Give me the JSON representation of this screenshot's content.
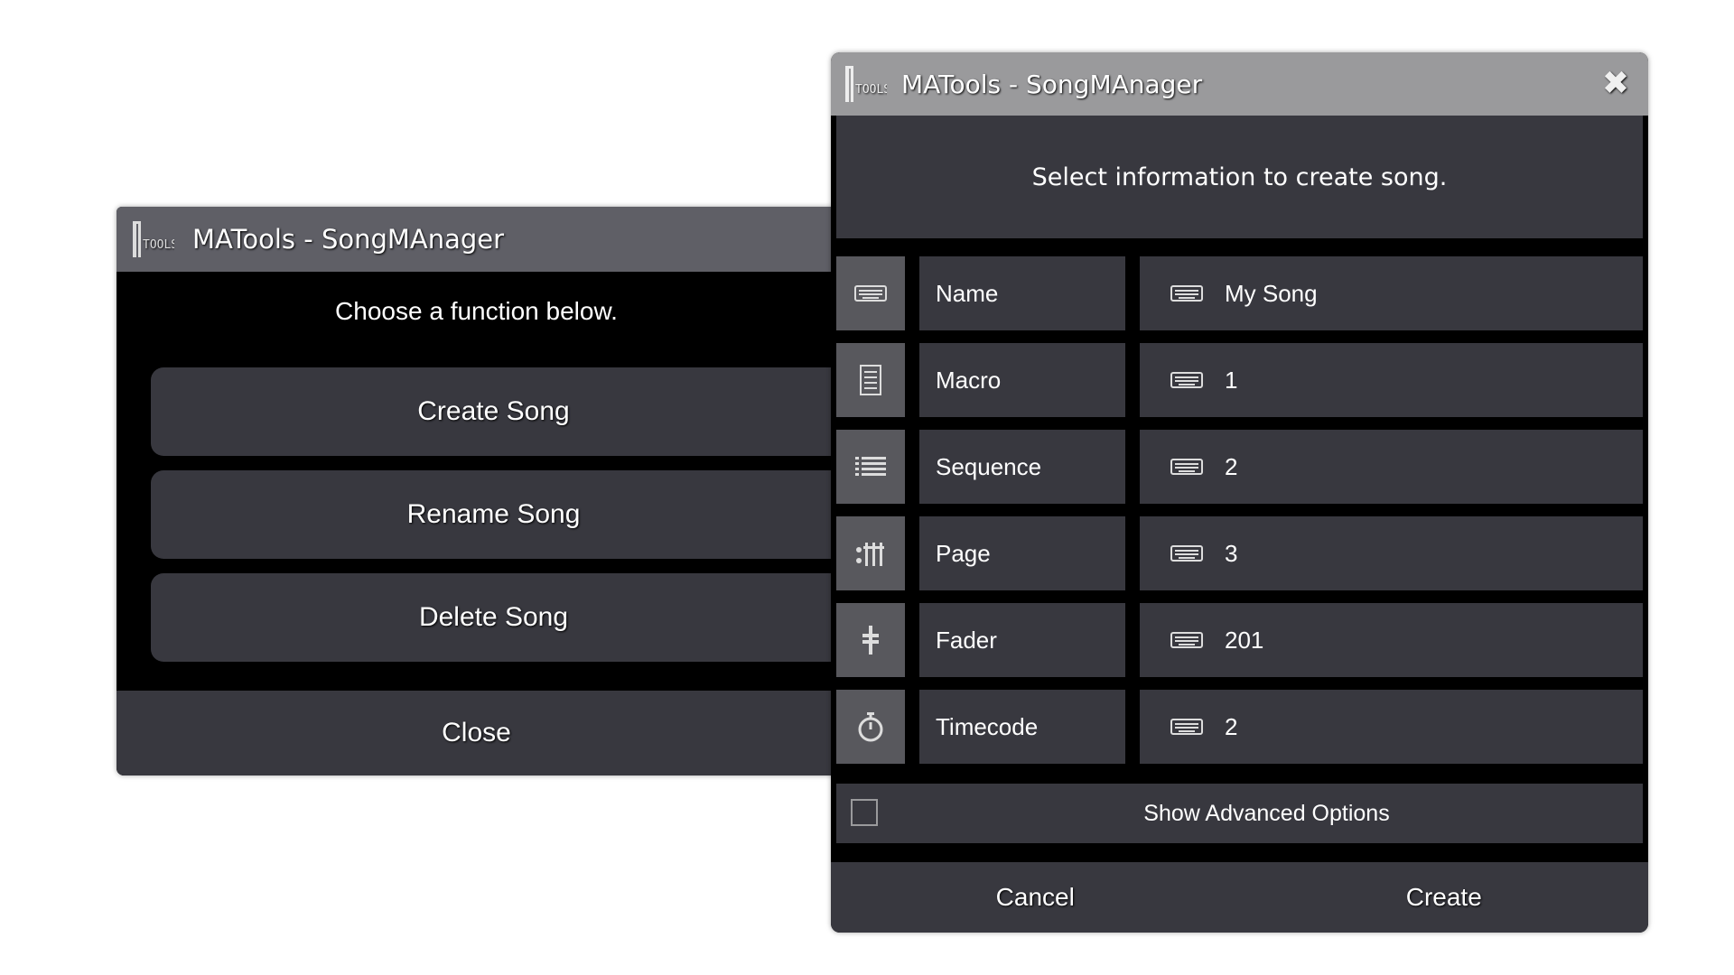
{
  "left_window": {
    "title": "MATools - SongMAnager",
    "prompt": "Choose a function below.",
    "buttons": [
      {
        "label": "Create Song"
      },
      {
        "label": "Rename Song"
      },
      {
        "label": "Delete Song"
      }
    ],
    "close_label": "Close"
  },
  "right_window": {
    "title": "MATools - SongMAnager",
    "header": "Select information to create song.",
    "rows": [
      {
        "icon": "keyboard-icon",
        "label": "Name",
        "value": "My Song"
      },
      {
        "icon": "macro-icon",
        "label": "Macro",
        "value": "1"
      },
      {
        "icon": "sequence-list-icon",
        "label": "Sequence",
        "value": "2"
      },
      {
        "icon": "page-faders-icon",
        "label": "Page",
        "value": "3"
      },
      {
        "icon": "fader-icon",
        "label": "Fader",
        "value": "201"
      },
      {
        "icon": "stopwatch-icon",
        "label": "Timecode",
        "value": "2"
      }
    ],
    "advanced_label": "Show Advanced Options",
    "advanced_checked": false,
    "cancel_label": "Cancel",
    "create_label": "Create"
  },
  "colors": {
    "background": "#ffffff",
    "panel": "#38383f",
    "icon_cell": "#58585d",
    "left_titlebar": "#5f5f66",
    "right_titlebar": "#9a9a9c"
  }
}
